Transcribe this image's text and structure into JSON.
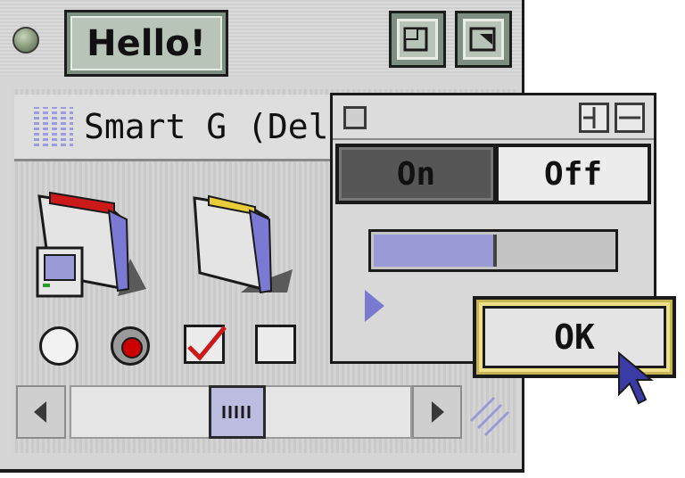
{
  "window": {
    "title": "Hello!",
    "header_text": "Smart G (Delt"
  },
  "popover": {
    "segment_on": "On",
    "segment_off": "Off",
    "progress_fraction": 0.5
  },
  "dialog": {
    "ok_label": "OK"
  },
  "colors": {
    "accent": "#9a9ad6",
    "title_field": "#b9c4b8",
    "ok_ring": "#eedf8a",
    "radio_selected": "#cc0000"
  },
  "icons": [
    "dot-icon",
    "zoom-icon",
    "collapse-icon",
    "grid-icon",
    "folder-icon",
    "mac-icon",
    "close-icon",
    "triangle-icon",
    "cursor-icon"
  ]
}
